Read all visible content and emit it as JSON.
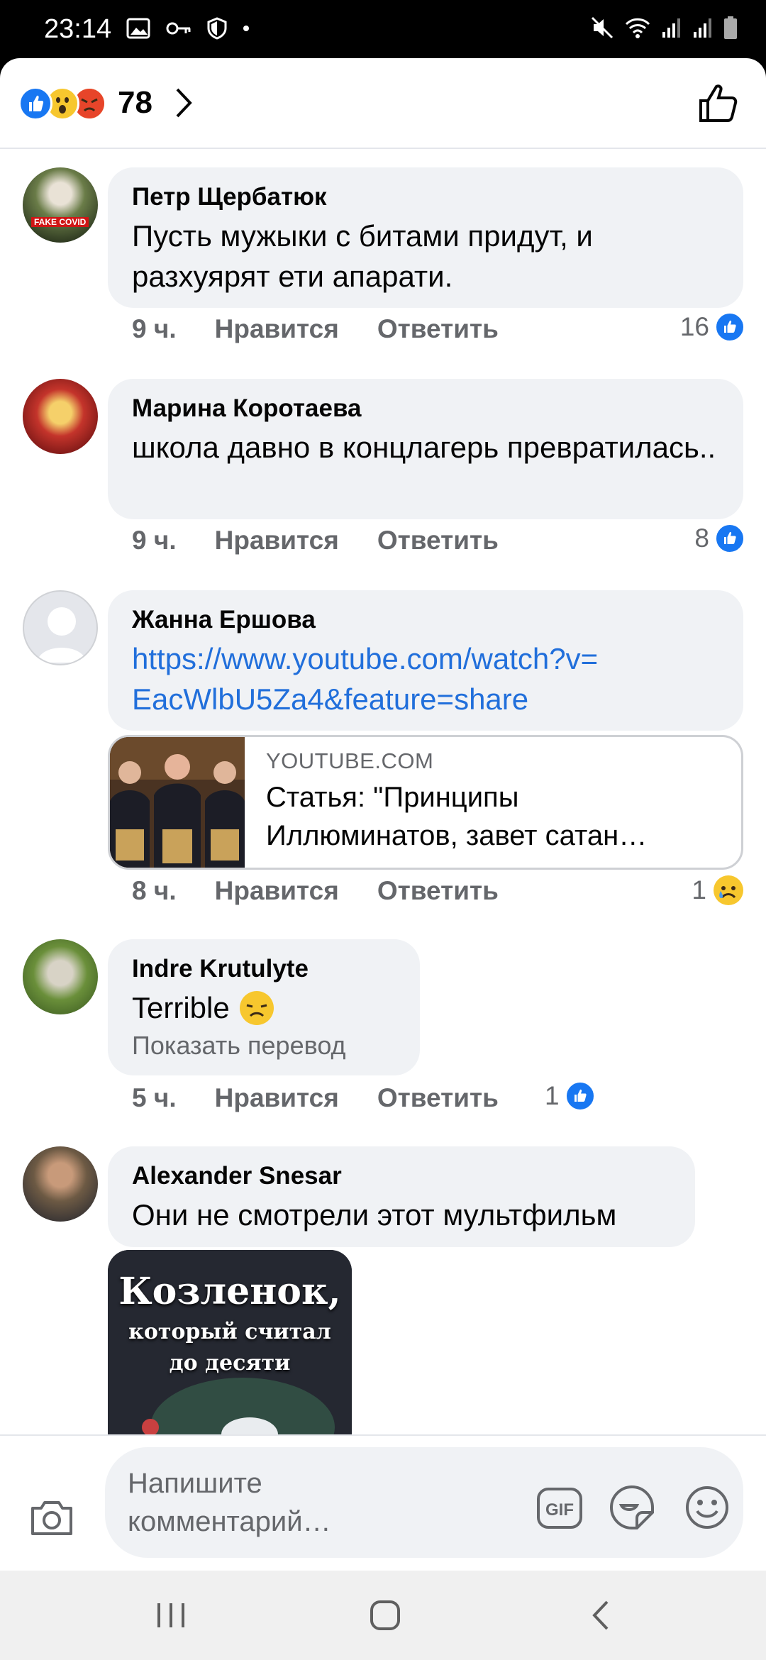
{
  "status_bar": {
    "time": "23:14"
  },
  "header": {
    "reaction_count": "78"
  },
  "comments": [
    {
      "author": "Петр Щербатюк",
      "text": "Пусть мужыки с битами придут, и разхуярят ети апарати.",
      "time": "9 ч.",
      "like_label": "Нравится",
      "reply_label": "Ответить",
      "reactions": "16"
    },
    {
      "author": "Марина Коротаева",
      "text": "школа давно в концлагерь превратилась..",
      "time": "9 ч.",
      "like_label": "Нравится",
      "reply_label": "Ответить",
      "reactions": "8"
    },
    {
      "author": "Жанна Ершова",
      "link": "https://www.youtube.com/watch?v=EacWlbU5Za4&feature=share",
      "link_line1": "https://www.youtube.com/watch?v=",
      "link_line2": "EacWlbU5Za4&feature=share",
      "card_domain": "YOUTUBE.COM",
      "card_title_line1": "Статья: \"Принципы",
      "card_title_line2": "Иллюминатов, завет сатан…",
      "time": "8 ч.",
      "like_label": "Нравится",
      "reply_label": "Ответить",
      "reactions": "1"
    },
    {
      "author": "Indre Krutulyte",
      "text": "Terrible",
      "translate": "Показать перевод",
      "time": "5 ч.",
      "like_label": "Нравится",
      "reply_label": "Ответить",
      "reactions": "1"
    },
    {
      "author": "Alexander Snesar",
      "text": "Они не смотрели этот мультфильм",
      "gif_title": "Козленок,",
      "gif_sub_line1": "который считал",
      "gif_sub_line2": "до десяти"
    }
  ],
  "composer": {
    "placeholder_line1": "Напишите",
    "placeholder_line2": "комментарий…",
    "gif_label": "GIF"
  },
  "colors": {
    "accent": "#1877f2",
    "link": "#216fdb",
    "bubble": "#f0f2f5",
    "meta": "#65676b"
  }
}
